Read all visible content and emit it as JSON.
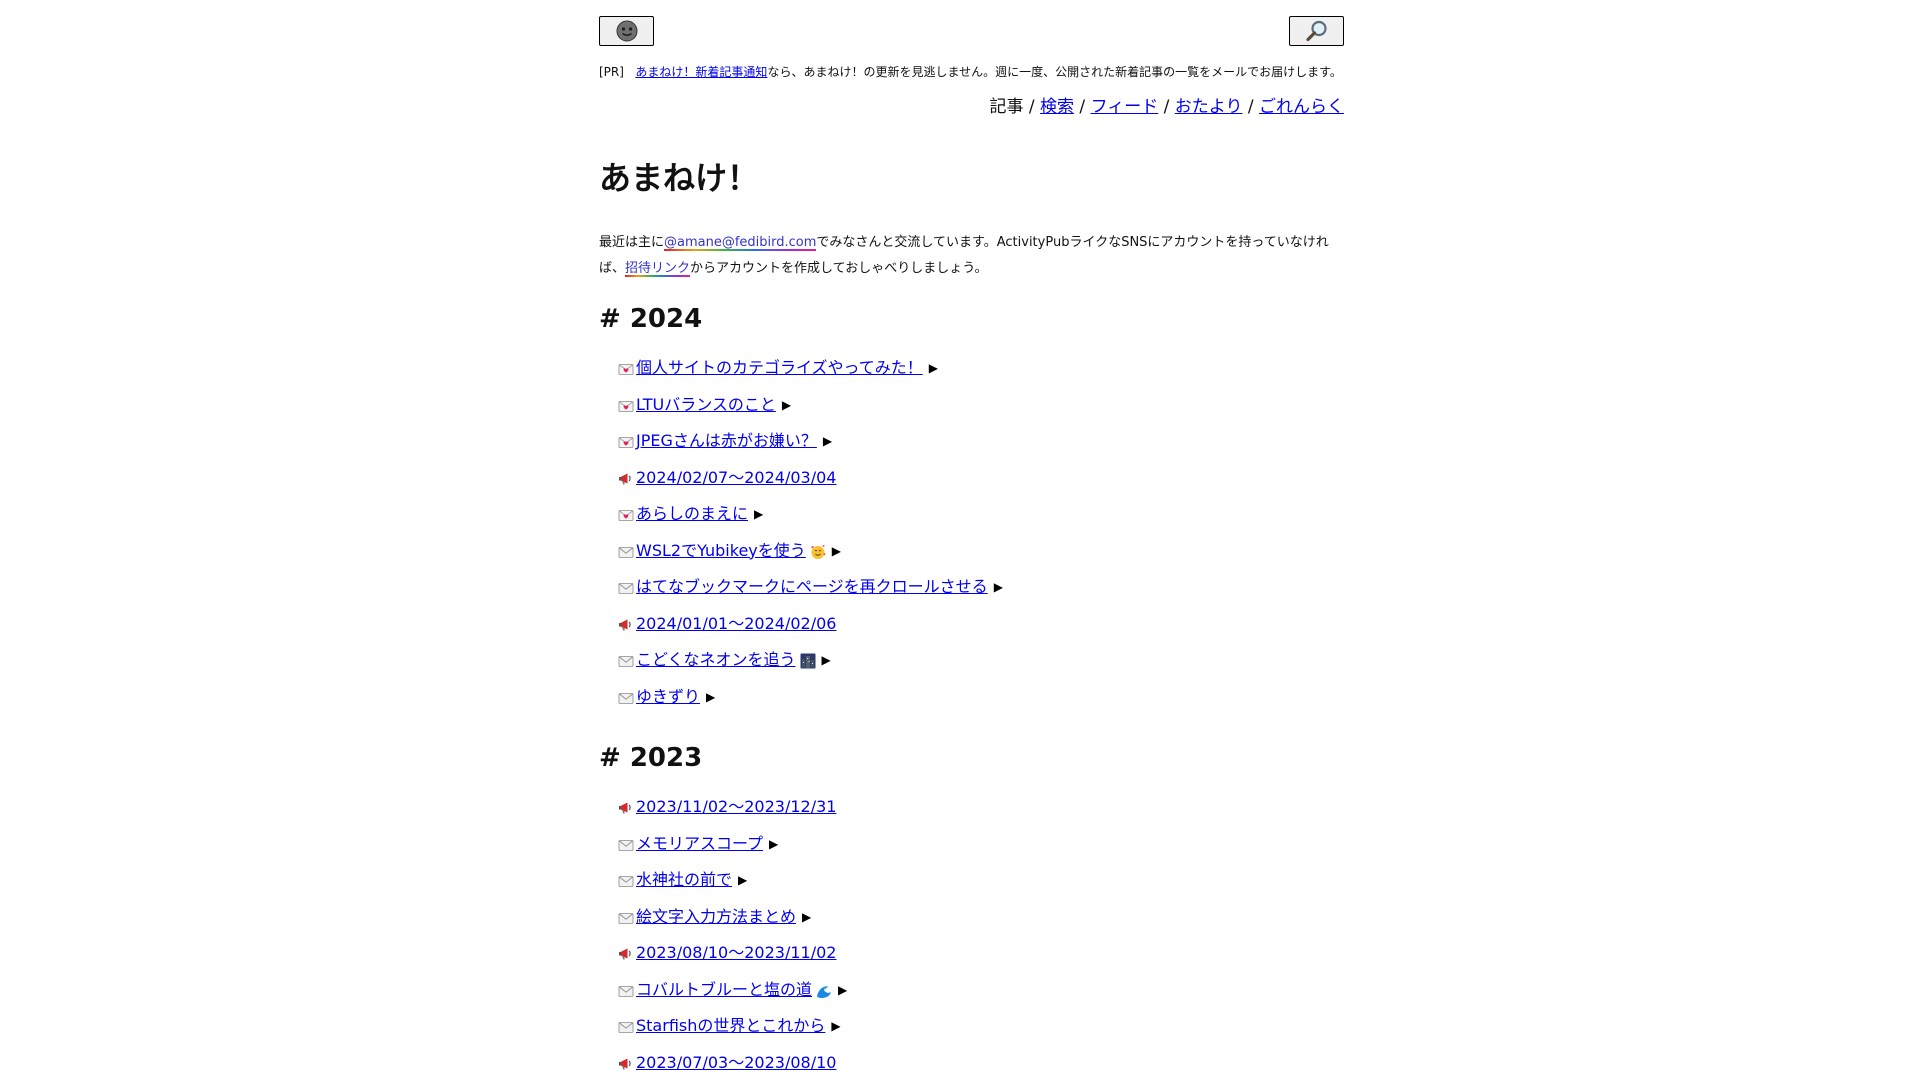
{
  "header": {
    "avatar_icon": "smiley-face-icon",
    "search_icon": "magnifier-icon"
  },
  "pr": {
    "tag": "[PR]",
    "link": "あまねけ！新着記事通知",
    "text": "なら、あまねけ！の更新を見逃しません。週に一度、公開された新着記事の一覧をメールでお届けします。"
  },
  "nav": {
    "current": "記事",
    "links": [
      "検索",
      "フィード",
      "おたより",
      "ごれんらく"
    ],
    "separator": "/"
  },
  "title": "あまねけ！",
  "intro": {
    "part1": "最近は主に",
    "handle": "@amane@fedibird.com",
    "part2": "でみなさんと交流しています。ActivityPubライクなSNSにアカウントを持っていなければ、",
    "invite": "招待リンク",
    "part3": "からアカウントを作成しておしゃべりしましょう。"
  },
  "arrow": "▶",
  "sections": [
    {
      "heading": "# 2024",
      "items": [
        {
          "kind": "heart-letter-icon",
          "title": "個人サイトのカテゴライズやってみた！",
          "arrow": true
        },
        {
          "kind": "heart-letter-icon",
          "title": "LTUバランスのこと",
          "arrow": true
        },
        {
          "kind": "heart-letter-icon",
          "title": "JPEGさんは赤がお嫌い？",
          "arrow": true
        },
        {
          "kind": "megaphone-icon",
          "title": "2024/02/07〜2024/03/04",
          "arrow": false
        },
        {
          "kind": "heart-letter-icon",
          "title": "あらしのまえに",
          "arrow": true
        },
        {
          "kind": "envelope-icon",
          "title": "WSL2でYubikeyを使う",
          "emoji": "smiling-hearts-face-icon",
          "arrow": true
        },
        {
          "kind": "envelope-icon",
          "title": "はてなブックマークにページを再クロールさせる",
          "arrow": true
        },
        {
          "kind": "megaphone-icon",
          "title": "2024/01/01〜2024/02/06",
          "arrow": false
        },
        {
          "kind": "envelope-icon",
          "title": "こどくなネオンを追う",
          "emoji": "night-city-icon",
          "arrow": true
        },
        {
          "kind": "envelope-icon",
          "title": "ゆきずり",
          "arrow": true
        }
      ]
    },
    {
      "heading": "# 2023",
      "items": [
        {
          "kind": "megaphone-icon",
          "title": "2023/11/02〜2023/12/31",
          "arrow": false
        },
        {
          "kind": "envelope-icon",
          "title": "メモリアスコープ",
          "arrow": true
        },
        {
          "kind": "envelope-icon",
          "title": "水神社の前で",
          "arrow": true
        },
        {
          "kind": "envelope-icon",
          "title": "絵文字入力方法まとめ",
          "arrow": true
        },
        {
          "kind": "megaphone-icon",
          "title": "2023/08/10〜2023/11/02",
          "arrow": false
        },
        {
          "kind": "envelope-icon",
          "title": "コバルトブルーと塩の道",
          "emoji": "water-wave-icon",
          "arrow": true
        },
        {
          "kind": "envelope-icon",
          "title": "Starfishの世界とこれから",
          "arrow": true
        },
        {
          "kind": "megaphone-icon",
          "title": "2023/07/03〜2023/08/10",
          "arrow": false
        }
      ]
    }
  ]
}
